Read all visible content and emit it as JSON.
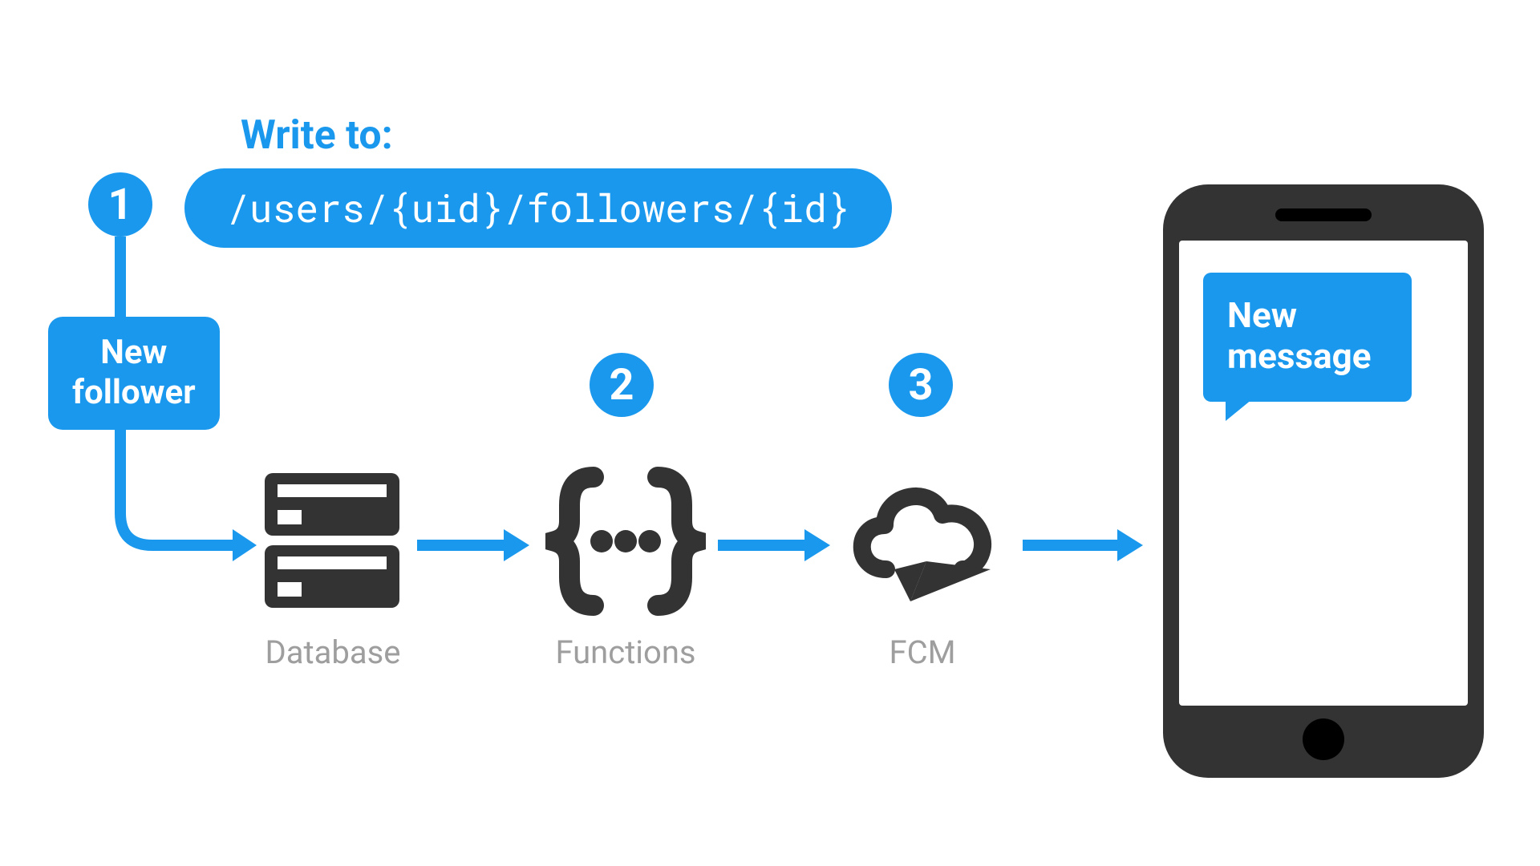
{
  "header": {
    "write_to_label": "Write to:",
    "code_path": "/users/{uid}/followers/{id}"
  },
  "steps": {
    "one": "1",
    "two": "2",
    "three": "3"
  },
  "follower_box": {
    "line1": "New",
    "line2": "follower"
  },
  "nodes": {
    "database_label": "Database",
    "functions_label": "Functions",
    "fcm_label": "FCM"
  },
  "phone": {
    "bubble_line1": "New",
    "bubble_line2": "message"
  },
  "colors": {
    "accent": "#1a98ed",
    "icon": "#333333",
    "label": "#9e9e9e"
  }
}
